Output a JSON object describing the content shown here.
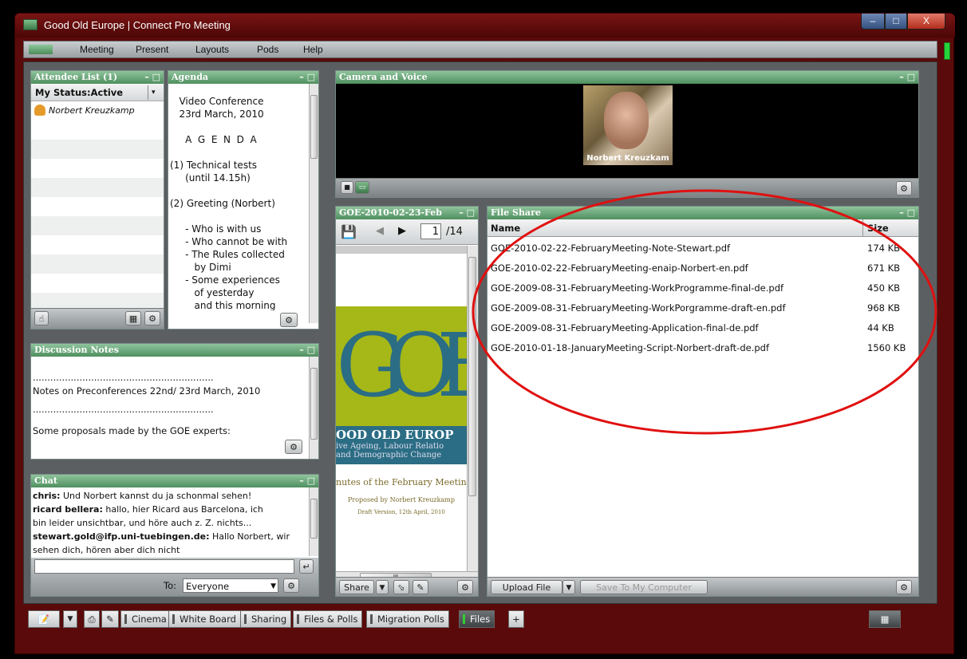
{
  "window": {
    "title": "Good Old Europe | Connect Pro Meeting",
    "min": "–",
    "max": "□",
    "close": "X"
  },
  "menu": [
    "Meeting",
    "Present",
    "Layouts",
    "Pods",
    "Help"
  ],
  "attendees": {
    "title": "Attendee List (1)",
    "status": "My Status:Active",
    "people": [
      "Norbert Kreuzkamp"
    ]
  },
  "agenda": {
    "title": "Agenda",
    "lines": [
      "   Video Conference",
      "   23rd March, 2010",
      "",
      "     A  G  E  N  D  A",
      "",
      "(1) Technical tests",
      "     (until 14.15h)",
      "",
      "(2) Greeting (Norbert)",
      "",
      "     - Who is with us",
      "     - Who cannot be with",
      "     - The Rules collected",
      "        by Dimi",
      "     - Some experiences",
      "        of yesterday",
      "        and this morning"
    ]
  },
  "camera": {
    "title": "Camera and Voice",
    "name": "Norbert Kreuzkam"
  },
  "doc": {
    "title": "GOE-2010-02-23-Feb",
    "page": "1",
    "total": "/14",
    "big_letters": "GOE",
    "brand": "OOD OLD EUROP",
    "sub1": "ive Ageing, Labour Relatio",
    "sub2": "and Demographic Change",
    "minutes": "nutes of the February Meetin",
    "proposed": "Proposed by Norbert Kreuzkamp",
    "draft": "Draft Version, 12th April, 2010",
    "share_label": "Share",
    "scroll_mid": "III"
  },
  "files": {
    "title": "File Share",
    "col_name": "Name",
    "col_size": "Size",
    "rows": [
      {
        "name": "GOE-2010-02-22-FebruaryMeeting-Note-Stewart.pdf",
        "size": "174 KB"
      },
      {
        "name": "GOE-2010-02-22-FebruaryMeeting-enaip-Norbert-en.pdf",
        "size": "671 KB"
      },
      {
        "name": "GOE-2009-08-31-FebruaryMeeting-WorkProgramme-final-de.pdf",
        "size": "450 KB"
      },
      {
        "name": "GOE-2009-08-31-FebruaryMeeting-WorkPorgramme-draft-en.pdf",
        "size": "968 KB"
      },
      {
        "name": "GOE-2009-08-31-FebruaryMeeting-Application-final-de.pdf",
        "size": "44 KB"
      },
      {
        "name": "GOE-2010-01-18-JanuaryMeeting-Script-Norbert-draft-de.pdf",
        "size": "1560 KB"
      }
    ],
    "upload": "Upload File",
    "save": "Save To My Computer"
  },
  "notes": {
    "title": "Discussion Notes",
    "dots": "..............................................................",
    "line1": "Notes on Preconferences 22nd/ 23rd March, 2010",
    "line2": "Some proposals made by the GOE experts:"
  },
  "chat": {
    "title": "Chat",
    "messages": [
      {
        "who": "chris:",
        "text": " Und Norbert kannst du ja schonmal sehen!"
      },
      {
        "who": "ricard bellera:",
        "text": " hallo, hier Ricard aus Barcelona, ich"
      },
      {
        "who": "",
        "text": "bin leider unsichtbar, und höre auch z. Z. nichts..."
      },
      {
        "who": "stewart.gold@ifp.uni-tuebingen.de:",
        "text": " Hallo Norbert, wir"
      },
      {
        "who": "",
        "text": "sehen dich, hören aber dich nicht"
      }
    ],
    "to_label": "To:",
    "to_value": "Everyone"
  },
  "tabs": [
    "Cinema",
    "White Board",
    "Sharing",
    "Files & Polls",
    "Migration Polls",
    "Files"
  ],
  "colors": {
    "annotation": "#e01010",
    "active_tab_bar": "#33cc33"
  }
}
